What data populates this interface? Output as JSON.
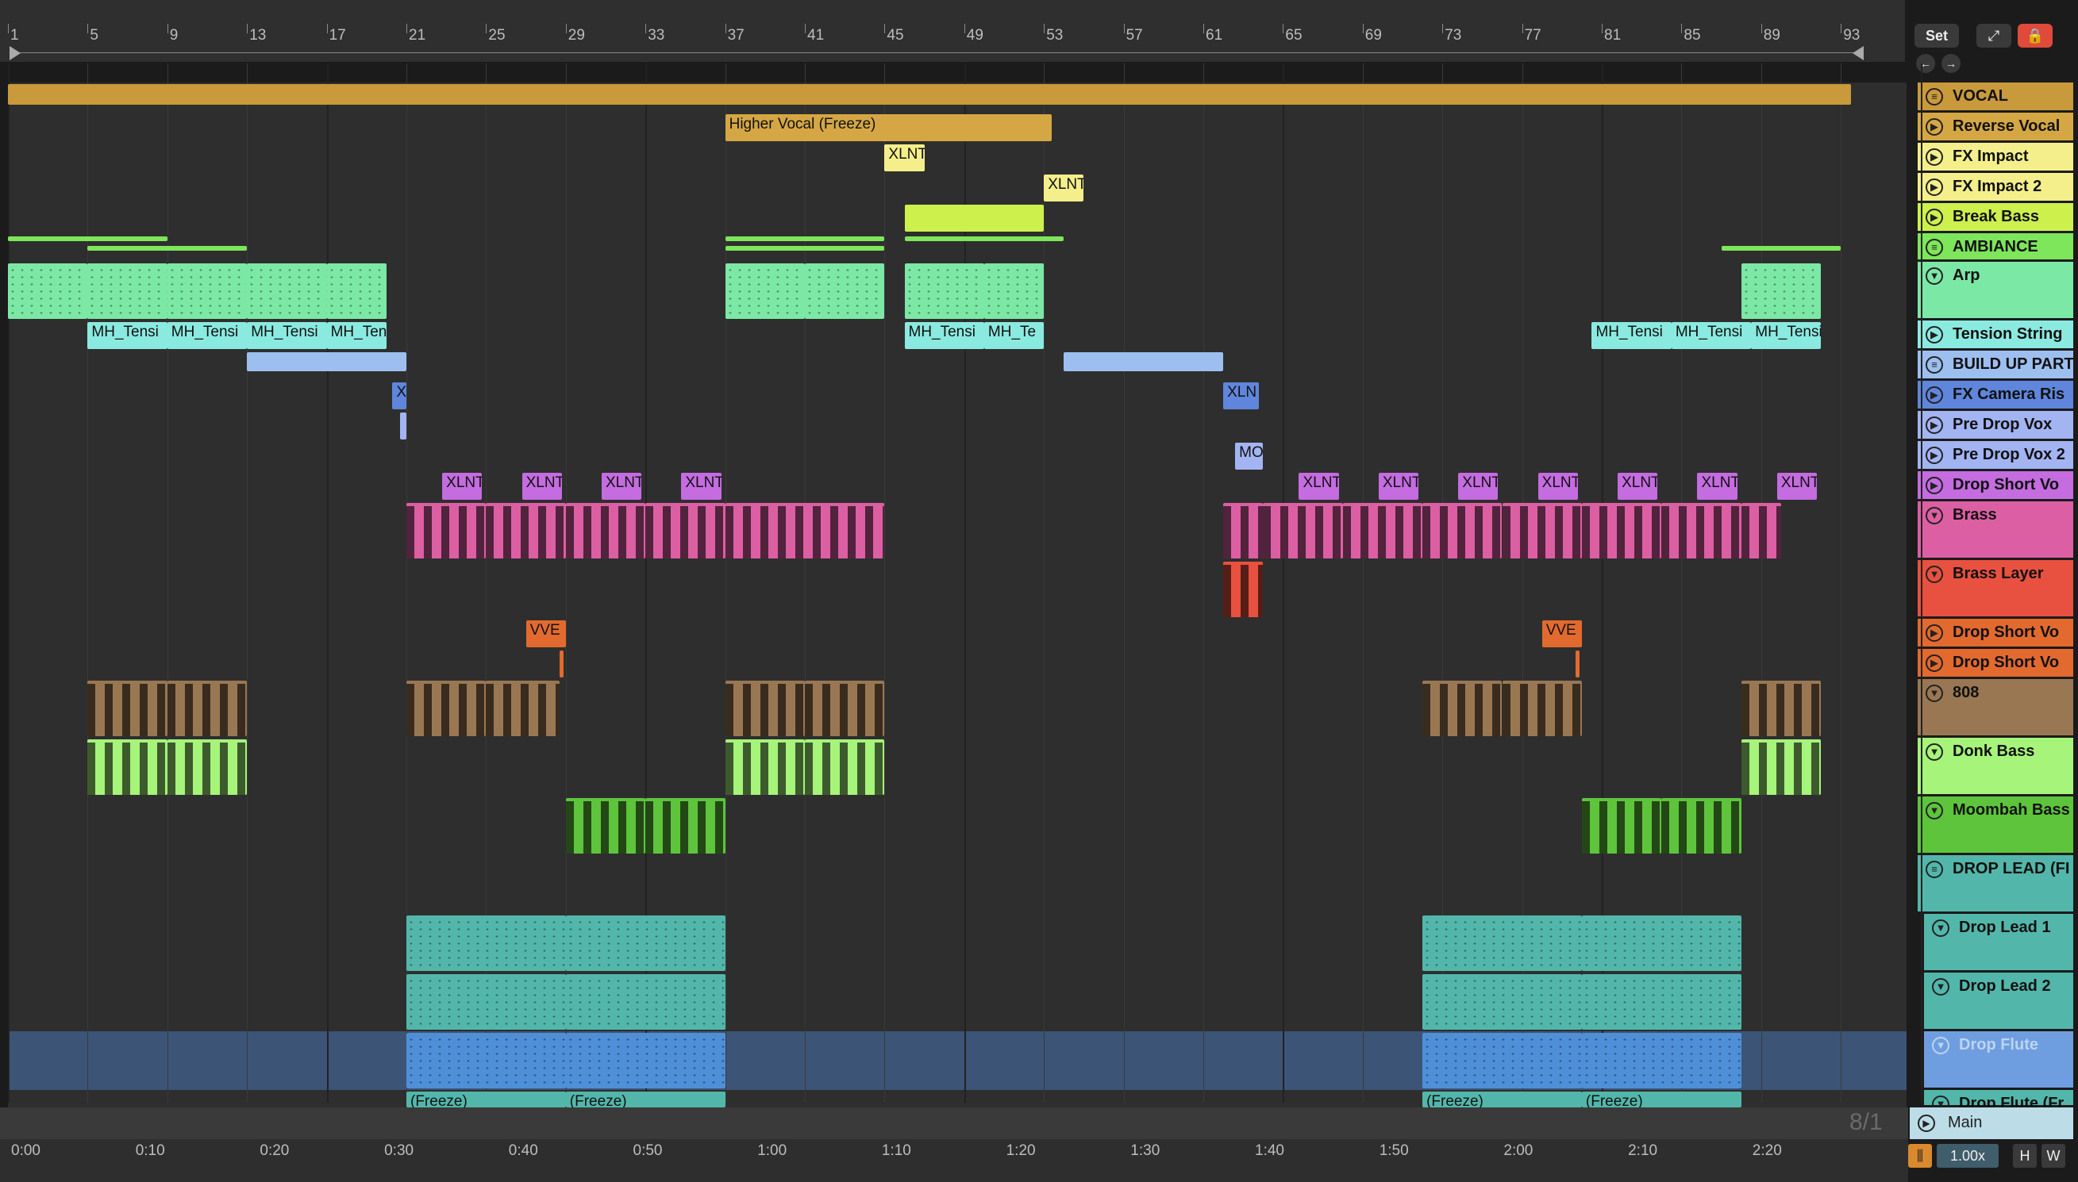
{
  "app": {
    "set_button": "Set",
    "position_display": "8/1",
    "zoom_value": "1.00x",
    "h_button": "H",
    "w_button": "W",
    "main_track": "Main"
  },
  "ruler": {
    "bars": [
      "1",
      "5",
      "9",
      "13",
      "17",
      "21",
      "25",
      "29",
      "33",
      "37",
      "41",
      "45",
      "49",
      "53",
      "57",
      "61",
      "65",
      "69",
      "73",
      "77",
      "81",
      "85",
      "89",
      "93"
    ]
  },
  "timeline": {
    "labels": [
      "0:00",
      "0:10",
      "0:20",
      "0:30",
      "0:40",
      "0:50",
      "1:00",
      "1:10",
      "1:20",
      "1:30",
      "1:40",
      "1:50",
      "2:00",
      "2:10",
      "2:20"
    ]
  },
  "tracks": [
    {
      "name": "VOCAL",
      "color": "#c99a3b",
      "icon": "group-icon"
    },
    {
      "name": "Reverse Vocal",
      "color": "#d5a744",
      "icon": "play-icon"
    },
    {
      "name": "FX Impact",
      "color": "#f4ef8a",
      "icon": "play-icon"
    },
    {
      "name": "FX Impact 2",
      "color": "#f4ef8a",
      "icon": "play-icon"
    },
    {
      "name": "Break Bass",
      "color": "#cdf04d",
      "icon": "play-icon"
    },
    {
      "name": "AMBIANCE",
      "color": "#7de65a",
      "icon": "group-icon"
    },
    {
      "name": "Arp",
      "color": "#7ce8a6",
      "icon": "fold-icon"
    },
    {
      "name": "Tension String",
      "color": "#8beae0",
      "icon": "play-icon"
    },
    {
      "name": "BUILD UP PART",
      "color": "#9dbff0",
      "icon": "group-icon"
    },
    {
      "name": "FX Camera Ris",
      "color": "#5f86dc",
      "icon": "play-icon"
    },
    {
      "name": "Pre Drop Vox",
      "color": "#a3b4f2",
      "icon": "play-icon"
    },
    {
      "name": "Pre Drop Vox 2",
      "color": "#a3b4f2",
      "icon": "play-icon"
    },
    {
      "name": "Drop Short Vo",
      "color": "#c46ce0",
      "icon": "play-icon"
    },
    {
      "name": "Brass",
      "color": "#dc5fa3",
      "icon": "fold-icon"
    },
    {
      "name": "Brass Layer",
      "color": "#e8513f",
      "icon": "fold-icon"
    },
    {
      "name": "Drop Short Vo",
      "color": "#e26a2e",
      "icon": "play-icon"
    },
    {
      "name": "Drop Short Vo",
      "color": "#e26a2e",
      "icon": "play-icon"
    },
    {
      "name": "808",
      "color": "#9a7753",
      "icon": "fold-icon"
    },
    {
      "name": "Donk Bass",
      "color": "#a6f47a",
      "icon": "fold-icon"
    },
    {
      "name": "Moombah Bass",
      "color": "#5ec43c",
      "icon": "fold-icon"
    },
    {
      "name": "DROP LEAD (FI",
      "color": "#52b7aa",
      "icon": "group-icon"
    },
    {
      "name": "Drop Lead 1",
      "color": "#52b7aa",
      "icon": "fold-icon"
    },
    {
      "name": "Drop Lead 2",
      "color": "#52b7aa",
      "icon": "fold-icon"
    },
    {
      "name": "Drop Flute",
      "color": "#4f8fd8",
      "icon": "fold-icon",
      "muted": true
    },
    {
      "name": "Drop Flute (Fr",
      "color": "#52b7aa",
      "icon": "fold-icon"
    }
  ],
  "clips": {
    "higher_vocal": "Higher Vocal (Freeze)",
    "xln": "XLNT",
    "xln_short": "XLN",
    "x": "X",
    "mh": "MH_Tensi",
    "mh_short": "MH_Te",
    "mo": "MO",
    "vve": "VVE",
    "freeze": "(Freeze)"
  }
}
